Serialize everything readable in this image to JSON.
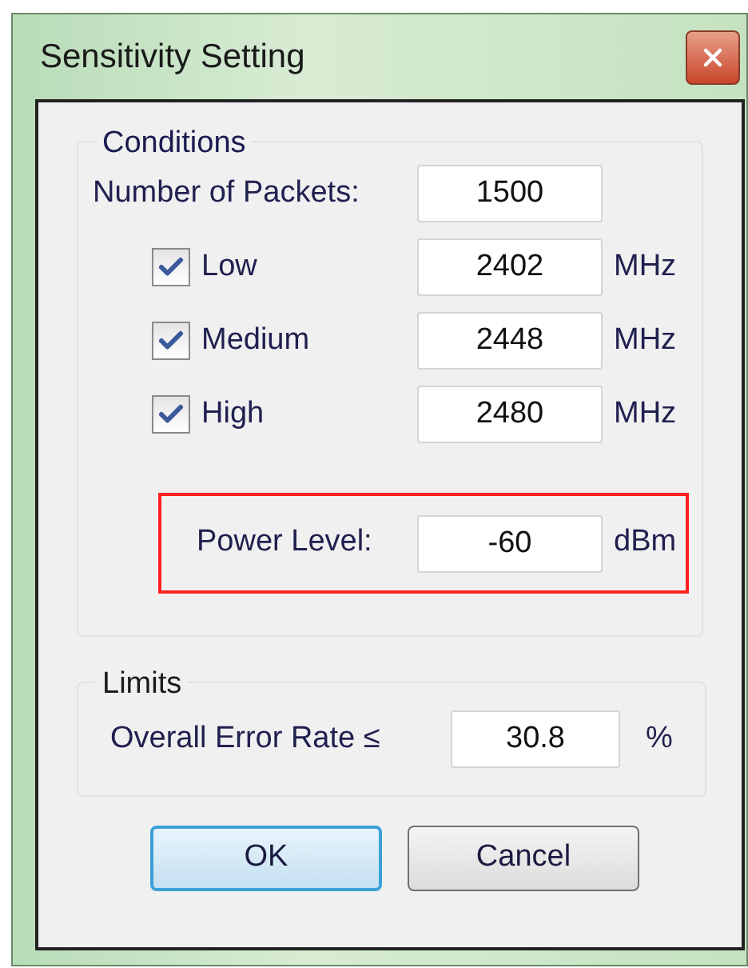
{
  "window": {
    "title": "Sensitivity Setting"
  },
  "conditions": {
    "title": "Conditions",
    "packets": {
      "label": "Number of Packets:",
      "value": "1500"
    },
    "channels": [
      {
        "label": "Low",
        "checked": true,
        "value": "2402",
        "unit": "MHz"
      },
      {
        "label": "Medium",
        "checked": true,
        "value": "2448",
        "unit": "MHz"
      },
      {
        "label": "High",
        "checked": true,
        "value": "2480",
        "unit": "MHz"
      }
    ],
    "power": {
      "label": "Power Level:",
      "value": "-60",
      "unit": "dBm",
      "highlighted": true
    }
  },
  "limits": {
    "title": "Limits",
    "error_rate": {
      "label": "Overall Error Rate ≤",
      "value": "30.8",
      "unit": "%"
    }
  },
  "buttons": [
    {
      "label": "OK",
      "default": true
    },
    {
      "label": "Cancel",
      "default": false
    }
  ]
}
